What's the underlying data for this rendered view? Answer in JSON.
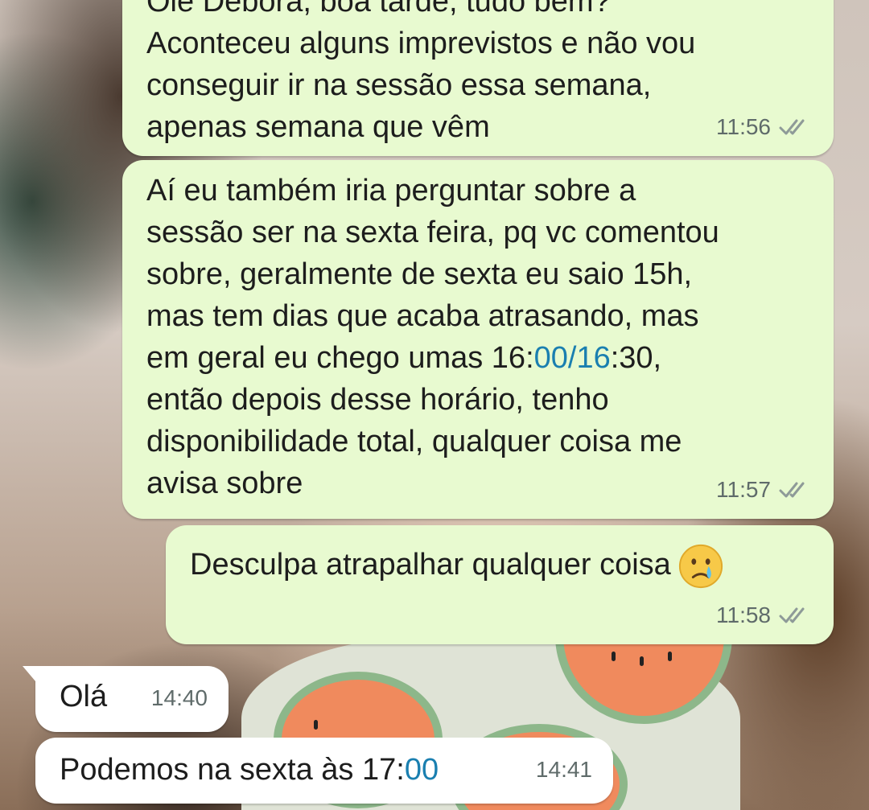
{
  "messages": [
    {
      "direction": "outgoing",
      "lines": [
        "Oie Débora, boa tarde, tudo bem?",
        "Aconteceu alguns imprevistos e não vou",
        "conseguir ir na sessão essa semana,",
        "apenas semana que vêm"
      ],
      "time": "11:56",
      "status_icon": "double-check-icon"
    },
    {
      "direction": "outgoing",
      "lines": [
        "Aí eu também iria perguntar sobre a",
        "sessão ser na sexta feira, pq vc comentou",
        "sobre, geralmente de sexta eu saio 15h,",
        "mas tem dias que acaba atrasando, mas",
        "em geral eu chego umas ",
        "então depois desse horário, tenho",
        "disponibilidade total, qualquer coisa me",
        "avisa sobre"
      ],
      "line5_parts": {
        "prefix": "em geral eu chego umas 16:",
        "link": "00/16",
        "suffix": ":30,"
      },
      "time": "11:57",
      "status_icon": "double-check-icon"
    },
    {
      "direction": "outgoing",
      "text": "Desculpa atrapalhar qualquer coisa",
      "emoji": "crying-face-emoji",
      "time": "11:58",
      "status_icon": "double-check-icon"
    },
    {
      "direction": "incoming",
      "text": "Olá",
      "time": "14:40"
    },
    {
      "direction": "incoming",
      "text_prefix": "Podemos na sexta às 17:",
      "text_link": "00",
      "time": "14:41"
    }
  ],
  "colors": {
    "outgoing_bubble": "#e8fad0",
    "incoming_bubble": "#ffffff",
    "link": "#1a7fb0",
    "meta_text": "#5f6b6a",
    "ticks": "#8e9a98"
  }
}
